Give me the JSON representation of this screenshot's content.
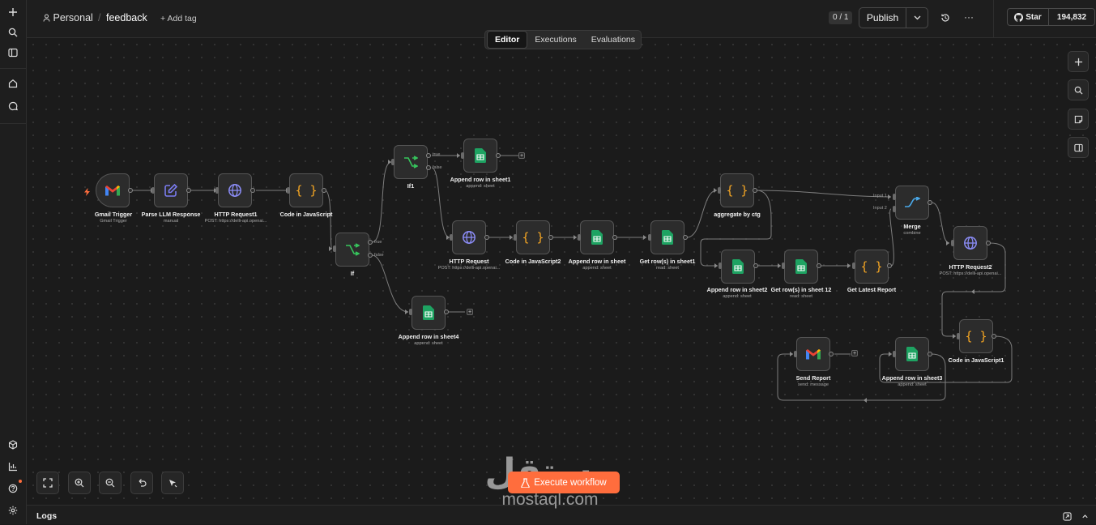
{
  "app": {
    "project": "Personal",
    "workflow_name": "feedback",
    "add_tag": "+ Add tag",
    "version_counter": "0 / 1",
    "publish_label": "Publish",
    "star_label": "Star",
    "star_count": "194,832"
  },
  "tabs": [
    {
      "label": "Editor",
      "active": true
    },
    {
      "label": "Executions",
      "active": false
    },
    {
      "label": "Evaluations",
      "active": false
    }
  ],
  "nodes": {
    "gmail_trigger": {
      "title": "Gmail Trigger",
      "sub": "Gmail Trigger"
    },
    "parse_llm": {
      "title": "Parse LLM Response",
      "sub": "manual"
    },
    "http_request1": {
      "title": "HTTP Request1",
      "sub": "POST: https://delli-api.openai..."
    },
    "code_js": {
      "title": "Code in JavaScript",
      "sub": ""
    },
    "if": {
      "title": "If",
      "sub": ""
    },
    "if1": {
      "title": "If1",
      "sub": ""
    },
    "append_sheet1": {
      "title": "Append row in sheet1",
      "sub": "append: sheet"
    },
    "http_request": {
      "title": "HTTP Request",
      "sub": "POST: https://delli-api.openai..."
    },
    "code_js2": {
      "title": "Code in JavaScript2",
      "sub": ""
    },
    "append_sheet": {
      "title": "Append row in sheet",
      "sub": "append: sheet"
    },
    "get_rows_sheet1": {
      "title": "Get row(s) in sheet1",
      "sub": "read: sheet"
    },
    "append_sheet4": {
      "title": "Append row in sheet4",
      "sub": "append: sheet"
    },
    "aggregate": {
      "title": "aggregate by ctg",
      "sub": ""
    },
    "append_sheet2": {
      "title": "Append row in sheet2",
      "sub": "append: sheet"
    },
    "get_rows_sheet12": {
      "title": "Get row(s) in sheet 12",
      "sub": "read: sheet"
    },
    "latest_report": {
      "title": "Get Latest Report",
      "sub": ""
    },
    "merge": {
      "title": "Merge",
      "sub": "combine"
    },
    "http_request2": {
      "title": "HTTP Request2",
      "sub": "POST: https://delli-api.openai..."
    },
    "code_js1": {
      "title": "Code in JavaScript1",
      "sub": ""
    },
    "append_sheet3": {
      "title": "Append row in sheet3",
      "sub": "append: sheet"
    },
    "send_report": {
      "title": "Send Report",
      "sub": "send: message"
    }
  },
  "branches": {
    "true": "true",
    "false": "false",
    "input1": "Input 1",
    "input2": "Input 2"
  },
  "execute_label": "Execute workflow",
  "logs_label": "Logs",
  "watermark": {
    "arabic": "مستقل",
    "latin": "mostaql.com"
  },
  "colors": {
    "accent": "#ff6d3d",
    "sheets": "#1ea362",
    "if_green": "#36c55c",
    "http": "#8b8cf6",
    "code": "#f5a623",
    "edit": "#7b7cf0",
    "merge": "#4aa8e8"
  },
  "icons": [
    "plus-icon",
    "search-icon",
    "panel-icon",
    "home-icon",
    "chat-icon",
    "user-icon",
    "history-icon",
    "more-icon",
    "github-icon",
    "fit-view-icon",
    "zoom-in-icon",
    "zoom-out-icon",
    "undo-icon",
    "cursor-icon",
    "flask-icon",
    "expand-icon"
  ]
}
